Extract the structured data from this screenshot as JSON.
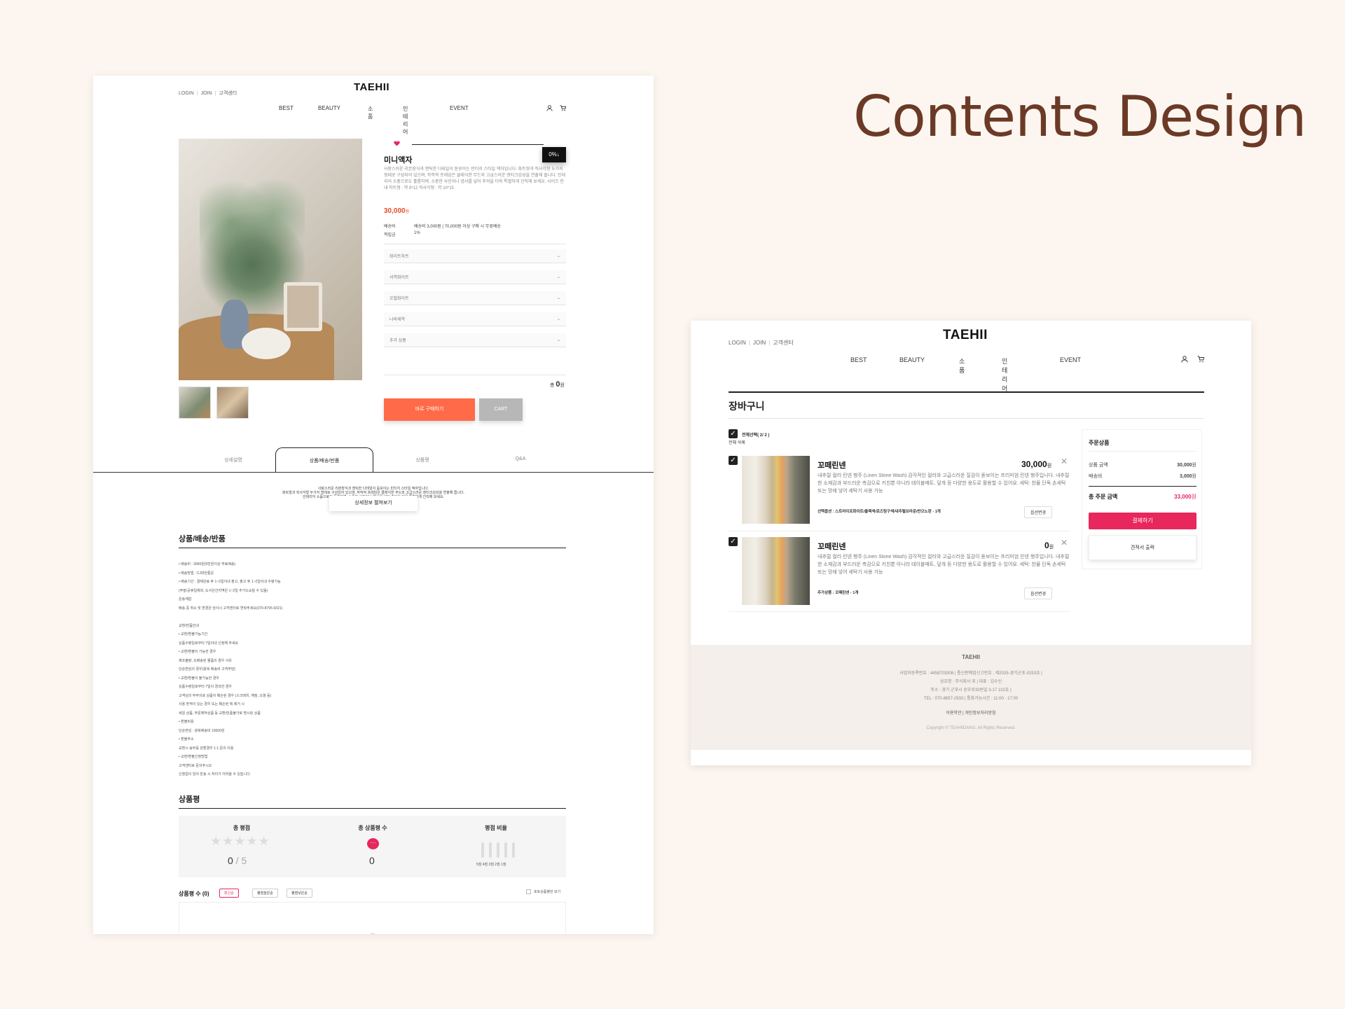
{
  "heading": "Contents Design",
  "header": {
    "links": [
      "LOGIN",
      "JOIN",
      "고객센터"
    ],
    "logo": "TAEHII",
    "nav": [
      "BEST",
      "BEAUTY",
      "소품",
      "인테리어",
      "EVENT"
    ]
  },
  "product": {
    "name": "미니액자",
    "description": "사랑스러운 리본장식과 앤틱한 디테일이 돋보이는 빈티지 스타일 액자입니다. 화트형과 직사각형 두가지 형태로 구성되어 있으며, 작작적 프레임은 클래식한 무드와 고급스러운 엔티크감성을 연출해 줍니다. 인테리어 소품으로도 훌륭하며, 소중한 사진이나 엽서를 넣어 추억을 더욱 특별하게 간직해 보세요. 사이즈 안내 하트형 : 약 9*12 직사각형 : 약 10*15",
    "price": "30,000",
    "price_unit": "원",
    "shipping_label": "배송비",
    "shipping_value": "배송비 3,000원 | 70,000원 이상 구매 시 무료배송",
    "points_label": "적립금",
    "points_value": "1%",
    "badge": "0%",
    "options": [
      "화이트하트",
      "서역화이트",
      "오벌화이트",
      "나비세역",
      "추가 상품"
    ],
    "total_label": "총",
    "total_value": "0",
    "total_unit": "원",
    "buy_label": "바로 구매하기",
    "cart_label": "CART"
  },
  "tabs": [
    "상세설명",
    "상품/배송/반품",
    "상품평",
    "Q&A"
  ],
  "detail_text": "사랑스러운 리본장식과 앤틱한 디테일이 돋보이는 빈티지 스타일 액자입니다.\n화트형과 직사각형 두가지 형태로 구성되어 있으며, 작작적 프레임은 클래식한 무드와 고급스러운 엔티크감성을 연출해 줍니다.\n인테리어 소품으로도 훌륭하며, 소중한 사진이나 엽서를 넣어 추억을 더욱 특별하게 간직해 보세요.",
  "detail_more": "상세정보 펼쳐보기",
  "shipping_section": {
    "title": "상품/배송/반품",
    "notes": "• 배송비 : 3000원(5만원이상 무료배송)\n• 배송방법 : CJ대한통운\n• 배송기간 : 결제완료 후 1~3일이내 출고, 출고 후 1~2일이내 수령가능\n(주말/공휴일제외, 도서산간지역은 1~2일 추가소요될 수 있음)\n운송계잡\n배송 중 취소 및 변경은 당사시 고객센터로 연락주세요(070-8795-9321)\n\n교환/반품안내\n• 교환/환불가능기간\n상품수령일로부터 7일이내 신청해 주세요\n• 교환/환불이 가능한 경우\n제조불량, 오배송된 물품의 경우 사유\n단순변심의 경우(왕복 배송비 고객부담)\n• 교환/환불이 불가능한 경우\n상품수령일로부터 7일이 경과한 경우\n고객님의 부주의로 상품이 훼손된 경우 (스크래치, 깨짐, 오염 등)\n사용 흔적이 있는 경우 또는 훼손된 택 제거 시\n세일 상품, 주문제작상품 등 교환/반품불가로 명시된 상품\n• 환불비용\n단순변심 : 왕복배송비 10000원\n• 환불주소\n교환시 송부를 원할경우 1:1 문의 이용\n• 교환/환불신청방법\n고객센터로 문의주시오\n신청없이 임의 반송 시 처리가 어려울 수 있습니다."
  },
  "review_section": {
    "title": "상품평",
    "avg_label": "총 평점",
    "avg_value": "0",
    "avg_max": "/ 5",
    "count_label": "총 상품평 수",
    "count_value": "0",
    "ratio_label": "평점 비율",
    "ratio_ticks": "5점 4점 3점 2점 1점",
    "list_title": "상품평 수 (0)",
    "sort": [
      "최신순",
      "평점높은순",
      "평점낮은순"
    ],
    "photo_only": "포토상품평만 보기"
  },
  "cart": {
    "title": "장바구니",
    "select_all": "전체선택( 2/ 2 )",
    "delete_all": "전체 삭제",
    "items": [
      {
        "name": "꼬떼린넨",
        "price": "30,000",
        "unit": "원",
        "desc": "내추럴 컬러 린넨 행주 (Linen Stone Wash) 감각적인 컬러와 고급스러운 질감이 돋보이는 프리미엄 린넨 행주입니다. 내추럴한 소재감과 부드러운 촉감으로 키친뿐 아니라 테이블매트, 덮개 등 다양한 용도로 활용할 수 있어요. 세탁: 찬물 단독 손세탁 또는 망에 넣어 세탁기 사용 가능",
        "option": "선택옵션 : 스트라이프화이트/올렉색/로즈팅구색/내추럴브라운/반으노란 - 1개",
        "option_button": "옵션변경"
      },
      {
        "name": "꼬떼린넨",
        "price": "0",
        "unit": "원",
        "desc": "내추럴 컬러 린넨 행주 (Linen Stone Wash) 감각적인 컬러와 고급스러운 질감이 돋보이는 프리미엄 린넨 행주입니다. 내추럴한 소재감과 부드러운 촉감으로 키친뿐 아니라 테이블매트, 덮개 등 다양한 용도로 활용할 수 있어요. 세탁: 찬물 단독 손세탁 또는 망에 넣어 세탁기 사용 가능",
        "option": "추가상품 : 꼬떼린넨 - 1개",
        "option_button": "옵션변경"
      }
    ],
    "summary": {
      "title": "주문상품",
      "subtotal_label": "상품 금액",
      "subtotal_value": "30,000",
      "shipping_label": "배송비",
      "shipping_value": "3,000",
      "total_label": "총 주문 금액",
      "total_value": "33,000",
      "unit": "원",
      "pay_label": "결제하기",
      "quote_label": "견적서 출력"
    }
  },
  "footer": {
    "brand": "TAEHII",
    "line1": "사업자등록번호 : 4458703308 | 통신판매업신고번호 : 제2025-경기군포-0253호 |",
    "line2": "상호명 : 주식회사 위 | 대표 : 김수신",
    "line3": "주소 : 경기 군포시 송부로33번길 3-17 102호 |",
    "line4": "TEL : 070-8657-2933 | 통화가능시간 : 11:00 - 17:00",
    "links": "이용약관 | 개인정보처리방침",
    "copyright": "Copyright © TEAHIIDANG. All Rights Reserved."
  },
  "colors": {
    "background": "#fdf6f0",
    "heading": "#6b3a26",
    "buy_button": "#ff6b48",
    "price_accent": "#e64b2a",
    "pay_button": "#e8275d"
  }
}
